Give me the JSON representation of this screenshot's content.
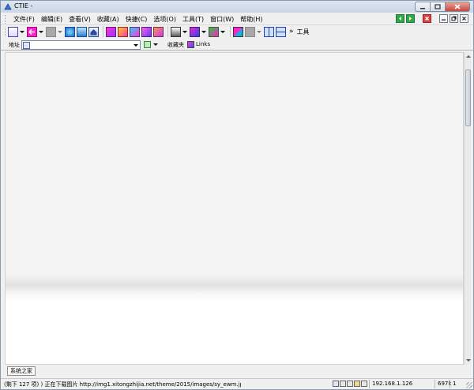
{
  "window": {
    "title": "CTIE -"
  },
  "menubar": {
    "items": [
      {
        "label": "文件(F)"
      },
      {
        "label": "编辑(E)"
      },
      {
        "label": "查看(V)"
      },
      {
        "label": "收藏(A)"
      },
      {
        "label": "快捷(C)"
      },
      {
        "label": "选项(O)"
      },
      {
        "label": "工具(T)"
      },
      {
        "label": "窗口(W)"
      },
      {
        "label": "帮助(H)"
      }
    ]
  },
  "toolbar": {
    "overflow_label": "»",
    "label": "工具",
    "colors": {
      "magenta": "#ff22cc",
      "blue": "#2255ee",
      "gray": "#a8a8a8",
      "green": "#22aa44",
      "cyan": "#11aacc"
    }
  },
  "address": {
    "label": "地址",
    "value": "",
    "favorites_label": "收藏夹",
    "links_label": "Links"
  },
  "tabs": [
    {
      "label": "系统之家"
    }
  ],
  "status": {
    "text": "(剩下 127 项) ) 正在下载图片 http://img1.xitongzhijia.net/theme/2015/images/sy_ewm.jpg...",
    "ip": "192.168.1.126",
    "size": "697k",
    "count": "1"
  }
}
